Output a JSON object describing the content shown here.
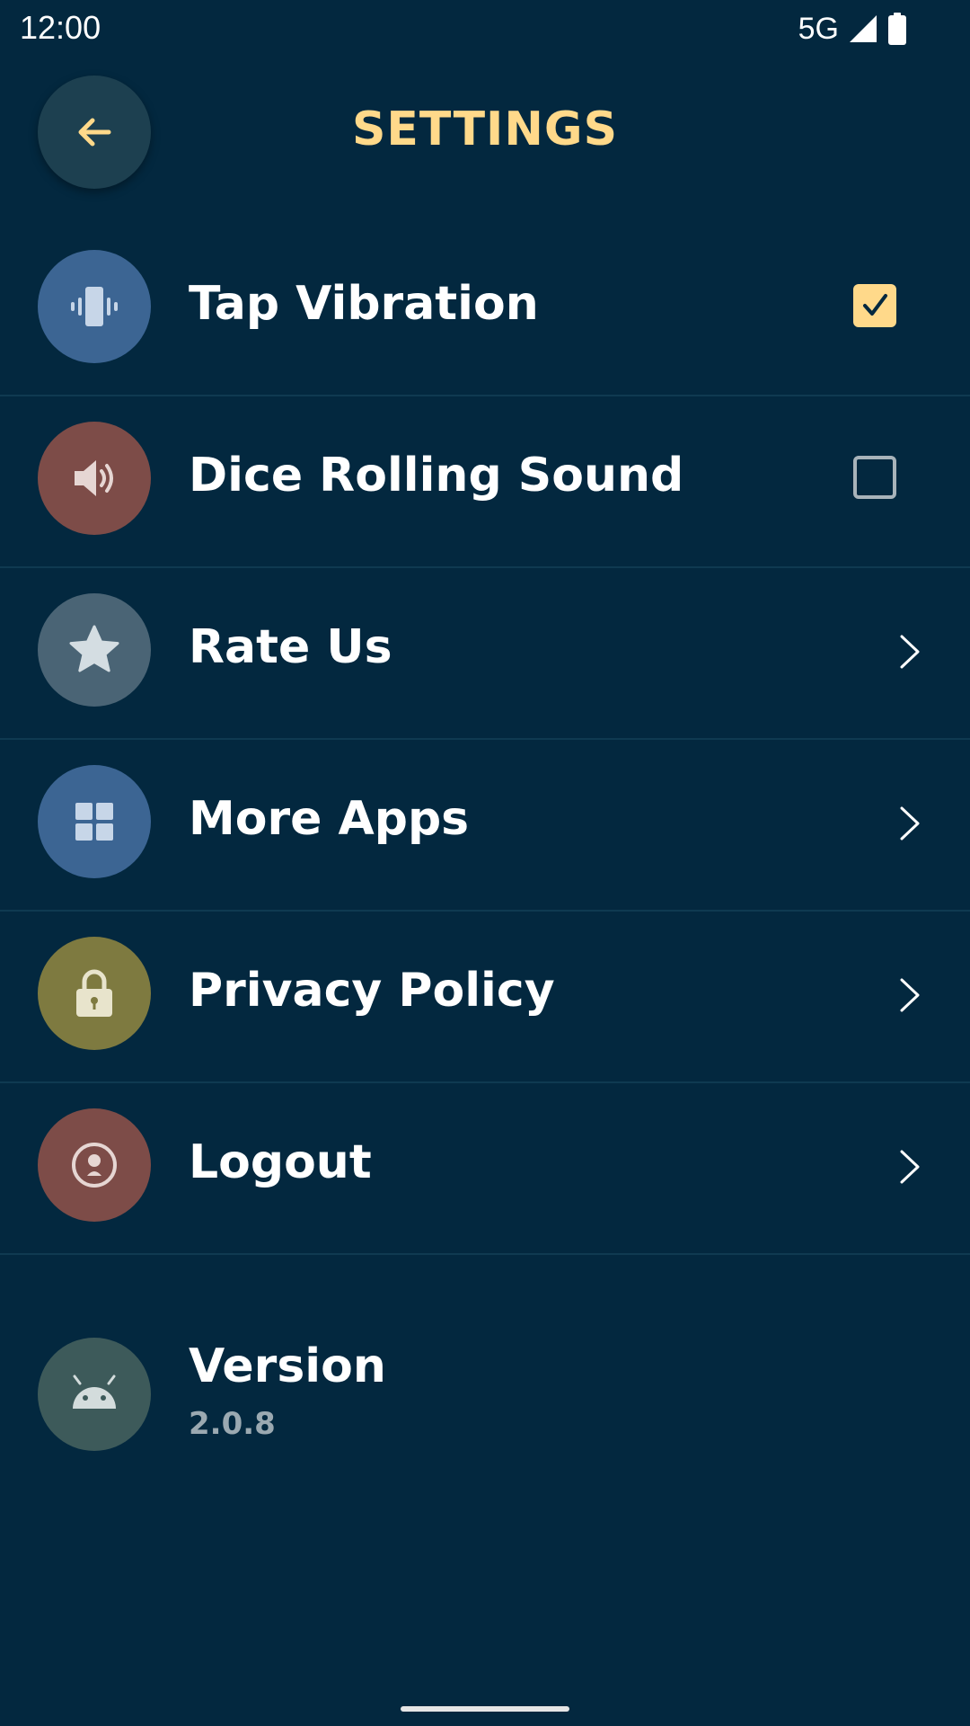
{
  "status_bar": {
    "time": "12:00",
    "network": "5G",
    "icons": [
      "signal-icon",
      "battery-icon"
    ]
  },
  "header": {
    "back_icon": "arrow-left-icon",
    "title": "SETTINGS"
  },
  "colors": {
    "background": "#03283f",
    "accent": "#ffd98a",
    "vibration_icon_bg": "#3c6593",
    "sound_icon_bg": "#7d4c48",
    "rate_icon_bg": "#4a6475",
    "apps_icon_bg": "#3c6593",
    "privacy_icon_bg": "#7e7a40",
    "logout_icon_bg": "#7d4c48",
    "version_icon_bg": "#3d5a5a"
  },
  "settings": {
    "tap_vibration": {
      "label": "Tap Vibration",
      "icon": "vibration-icon",
      "checked": true
    },
    "dice_sound": {
      "label": "Dice Rolling Sound",
      "icon": "speaker-icon",
      "checked": false
    },
    "rate_us": {
      "label": "Rate Us",
      "icon": "star-icon"
    },
    "more_apps": {
      "label": "More Apps",
      "icon": "grid-icon"
    },
    "privacy_policy": {
      "label": "Privacy Policy",
      "icon": "lock-icon"
    },
    "logout": {
      "label": "Logout",
      "icon": "account-icon"
    },
    "version": {
      "label": "Version",
      "value": "2.0.8",
      "icon": "android-icon"
    }
  }
}
